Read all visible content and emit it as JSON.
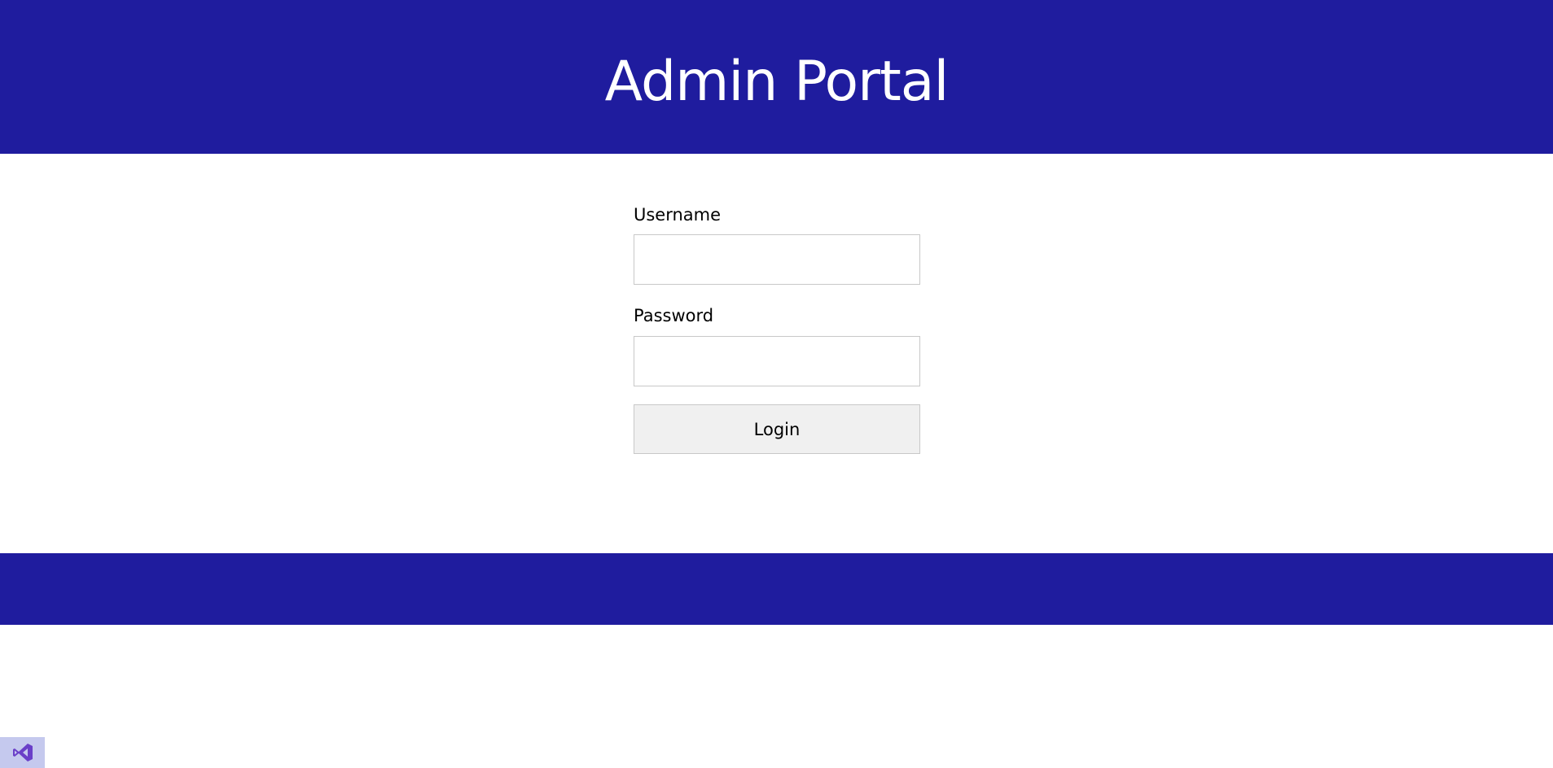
{
  "colors": {
    "brand": "#1f1c9e",
    "button_bg": "#f0f0f0",
    "badge_bg": "#c5c9ee",
    "badge_icon": "#6a3fc8"
  },
  "header": {
    "title": "Admin Portal"
  },
  "login_form": {
    "username_label": "Username",
    "username_value": "",
    "username_placeholder": "",
    "password_label": "Password",
    "password_value": "",
    "password_placeholder": "",
    "login_label": "Login"
  },
  "badge": {
    "icon": "visual-studio-icon"
  }
}
